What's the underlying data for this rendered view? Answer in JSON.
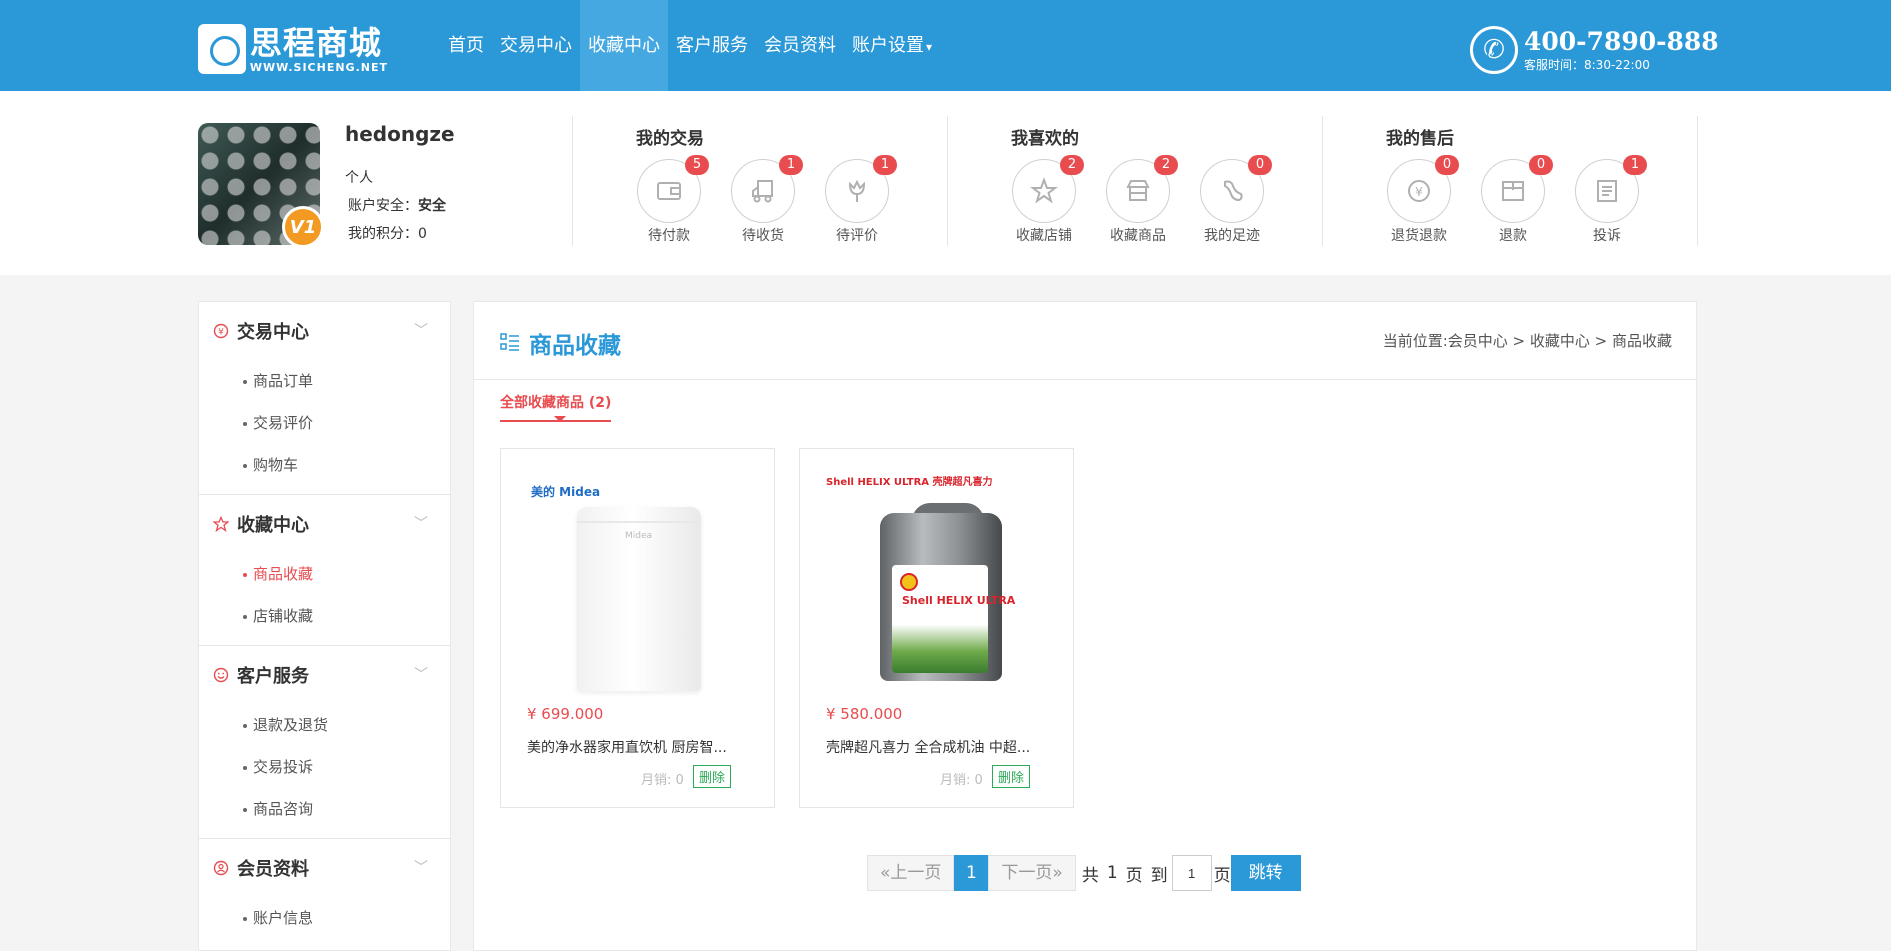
{
  "header": {
    "logo_name": "思程商城",
    "logo_url": "WWW.SICHENG.NET",
    "nav": [
      "首页",
      "交易中心",
      "收藏中心",
      "客户服务",
      "会员资料",
      "账户设置"
    ],
    "nav_active_index": 2,
    "hotline": "400-7890-888",
    "service_time": "客服时间：8:30-22:00"
  },
  "profile": {
    "username": "hedongze",
    "user_type": "个人",
    "security_label": "账户安全：",
    "security_value": "安全",
    "points_label": "我的积分：",
    "points_value": "0",
    "vip_level": "V1"
  },
  "groups": [
    {
      "title": "我的交易",
      "items": [
        {
          "label": "待付款",
          "count": "5",
          "icon": "wallet-icon"
        },
        {
          "label": "待收货",
          "count": "1",
          "icon": "truck-icon"
        },
        {
          "label": "待评价",
          "count": "1",
          "icon": "flower-icon"
        }
      ]
    },
    {
      "title": "我喜欢的",
      "items": [
        {
          "label": "收藏店铺",
          "count": "2",
          "icon": "star-icon"
        },
        {
          "label": "收藏商品",
          "count": "2",
          "icon": "shop-icon"
        },
        {
          "label": "我的足迹",
          "count": "0",
          "icon": "footprint-icon"
        }
      ]
    },
    {
      "title": "我的售后",
      "items": [
        {
          "label": "退货退款",
          "count": "0",
          "icon": "refund-icon"
        },
        {
          "label": "退款",
          "count": "0",
          "icon": "box-icon"
        },
        {
          "label": "投诉",
          "count": "1",
          "icon": "document-icon"
        }
      ]
    }
  ],
  "sidebar": [
    {
      "title": "交易中心",
      "icon": "yen-icon",
      "items": [
        "商品订单",
        "交易评价",
        "购物车"
      ]
    },
    {
      "title": "收藏中心",
      "icon": "star-icon",
      "items": [
        "商品收藏",
        "店铺收藏"
      ],
      "active_item": 0
    },
    {
      "title": "客户服务",
      "icon": "smile-icon",
      "items": [
        "退款及退货",
        "交易投诉",
        "商品咨询"
      ]
    },
    {
      "title": "会员资料",
      "icon": "user-icon",
      "items": [
        "账户信息"
      ]
    }
  ],
  "main": {
    "title": "商品收藏",
    "breadcrumb": "当前位置:会员中心 > 收藏中心 > 商品收藏",
    "tab": "全部收藏商品 (2)"
  },
  "products": [
    {
      "price": "¥ 699.000",
      "name": "美的净水器家用直饮机 厨房智...",
      "sales": "月销: 0",
      "delete": "删除",
      "brand": "美的 Midea",
      "product_logo": "Midea"
    },
    {
      "price": "¥ 580.000",
      "name": "壳牌超凡喜力 全合成机油 中超...",
      "sales": "月销: 0",
      "delete": "删除",
      "brand": "Shell HELIX ULTRA 壳牌超凡喜力",
      "product_label": "Shell HELIX ULTRA"
    }
  ],
  "pager": {
    "prev": "«上一页",
    "current": "1",
    "next": "下一页»",
    "total_prefix": "共",
    "total": "1",
    "total_suffix": "页",
    "to": "到",
    "input_value": "1",
    "page_suffix": "页",
    "go": "跳转"
  },
  "colors": {
    "primary": "#2b98d8",
    "accent": "#e84c4f",
    "success": "#2bab56"
  }
}
